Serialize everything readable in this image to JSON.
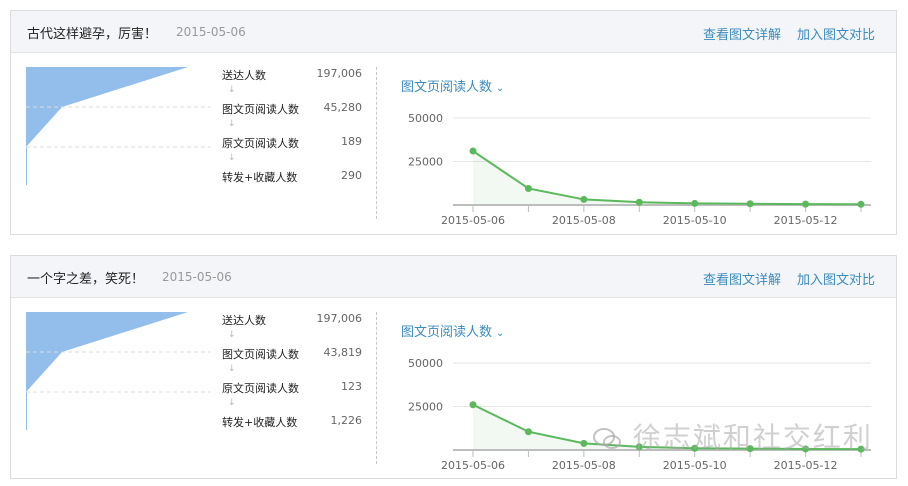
{
  "cards": [
    {
      "title": "古代这样避孕，厉害！",
      "date": "2015-05-06",
      "links": {
        "detail": "查看图文详解",
        "compare": "加入图文对比"
      },
      "funnel": [
        {
          "label": "送达人数",
          "value": "197,006"
        },
        {
          "label": "图文页阅读人数",
          "value": "45,280"
        },
        {
          "label": "原文页阅读人数",
          "value": "189"
        },
        {
          "label": "转发+收藏人数",
          "value": "290"
        }
      ],
      "metric_selector": "图文页阅读人数",
      "chart_data": {
        "type": "line",
        "x": [
          "2015-05-06",
          "2015-05-07",
          "2015-05-08",
          "2015-05-09",
          "2015-05-10",
          "2015-05-11",
          "2015-05-12",
          "2015-05-13"
        ],
        "x_tick_labels": [
          "2015-05-06",
          "2015-05-08",
          "2015-05-10",
          "2015-05-12"
        ],
        "y_tick_labels": [
          "50000",
          "25000"
        ],
        "ylim": [
          0,
          50000
        ],
        "series": [
          {
            "values": [
              31000,
              9500,
              3200,
              1600,
              900,
              700,
              500,
              400
            ]
          }
        ],
        "grid": true
      }
    },
    {
      "title": "一个字之差，笑死！",
      "date": "2015-05-06",
      "links": {
        "detail": "查看图文详解",
        "compare": "加入图文对比"
      },
      "funnel": [
        {
          "label": "送达人数",
          "value": "197,006"
        },
        {
          "label": "图文页阅读人数",
          "value": "43,819"
        },
        {
          "label": "原文页阅读人数",
          "value": "123"
        },
        {
          "label": "转发+收藏人数",
          "value": "1,226"
        }
      ],
      "metric_selector": "图文页阅读人数",
      "chart_data": {
        "type": "line",
        "x": [
          "2015-05-06",
          "2015-05-07",
          "2015-05-08",
          "2015-05-09",
          "2015-05-10",
          "2015-05-11",
          "2015-05-12",
          "2015-05-13"
        ],
        "x_tick_labels": [
          "2015-05-06",
          "2015-05-08",
          "2015-05-10",
          "2015-05-12"
        ],
        "y_tick_labels": [
          "50000",
          "25000"
        ],
        "ylim": [
          0,
          50000
        ],
        "series": [
          {
            "values": [
              26000,
              10500,
              3800,
              1800,
              1000,
              800,
              600,
              500
            ]
          }
        ],
        "grid": true
      }
    }
  ],
  "watermark": "徐志斌和社交红利",
  "colors": {
    "link": "#3a8bbf",
    "funnel_fill": "#93bdea",
    "line": "#5cb85c",
    "grid": "#e6e6e6",
    "axis": "#bdbdbd"
  }
}
